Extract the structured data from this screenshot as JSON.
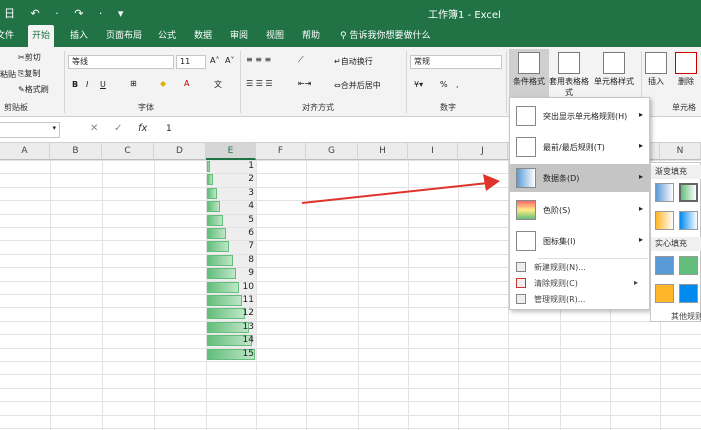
{
  "titlebar": {
    "title": "工作簿1 - Excel",
    "qat": "日 ↶ · ↷ · ▾"
  },
  "tabs": [
    "文件",
    "开始",
    "插入",
    "页面布局",
    "公式",
    "数据",
    "审阅",
    "视图",
    "帮助"
  ],
  "search_label": "告诉我你想要做什么",
  "ribbon": {
    "clipboard": {
      "paste": "粘贴",
      "cut": "剪切",
      "copy": "复制",
      "format_painter": "格式刷",
      "label": "剪贴板"
    },
    "font": {
      "name": "等线",
      "size": "11",
      "grow": "A˄",
      "shrink": "A˅",
      "bold": "B",
      "italic": "I",
      "underline": "U",
      "label": "字体"
    },
    "alignment": {
      "wrap": "自动换行",
      "merge": "合并后居中",
      "label": "对齐方式"
    },
    "number": {
      "format": "常规",
      "percent": "%",
      "comma": ",",
      "label": "数字"
    },
    "styles": {
      "conditional": "条件格式",
      "table": "套用表格格式",
      "cell_styles": "单元格样式"
    },
    "cells": {
      "insert": "插入",
      "delete": "删除",
      "label": "单元格"
    }
  },
  "formulabar": {
    "cancel": "✕",
    "enter": "✓",
    "fx": "fx",
    "value": "1"
  },
  "columns": [
    "A",
    "B",
    "C",
    "D",
    "E",
    "F",
    "G",
    "H",
    "I",
    "J",
    "K",
    "L",
    "M",
    "N"
  ],
  "values": [
    1,
    2,
    3,
    4,
    5,
    6,
    7,
    8,
    9,
    10,
    11,
    12,
    13,
    14,
    15
  ],
  "menu": {
    "items": [
      {
        "label": "突出显示单元格规则(H)",
        "arrow": "▸"
      },
      {
        "label": "最前/最后规则(T)",
        "arrow": "▸"
      },
      {
        "label": "数据条(D)",
        "arrow": "▸"
      },
      {
        "label": "色阶(S)",
        "arrow": "▸"
      },
      {
        "label": "图标集(I)",
        "arrow": "▸"
      }
    ],
    "small": [
      {
        "label": "新建规则(N)..."
      },
      {
        "label": "清除规则(C)",
        "arrow": "▸"
      },
      {
        "label": "管理规则(R)..."
      }
    ]
  },
  "submenu": {
    "gradient": "渐变填充",
    "solid": "实心填充",
    "more": "其他规则"
  },
  "colors": {
    "excel_green": "#217346",
    "databar": "#63be7b",
    "arrow": "#e0332b"
  }
}
